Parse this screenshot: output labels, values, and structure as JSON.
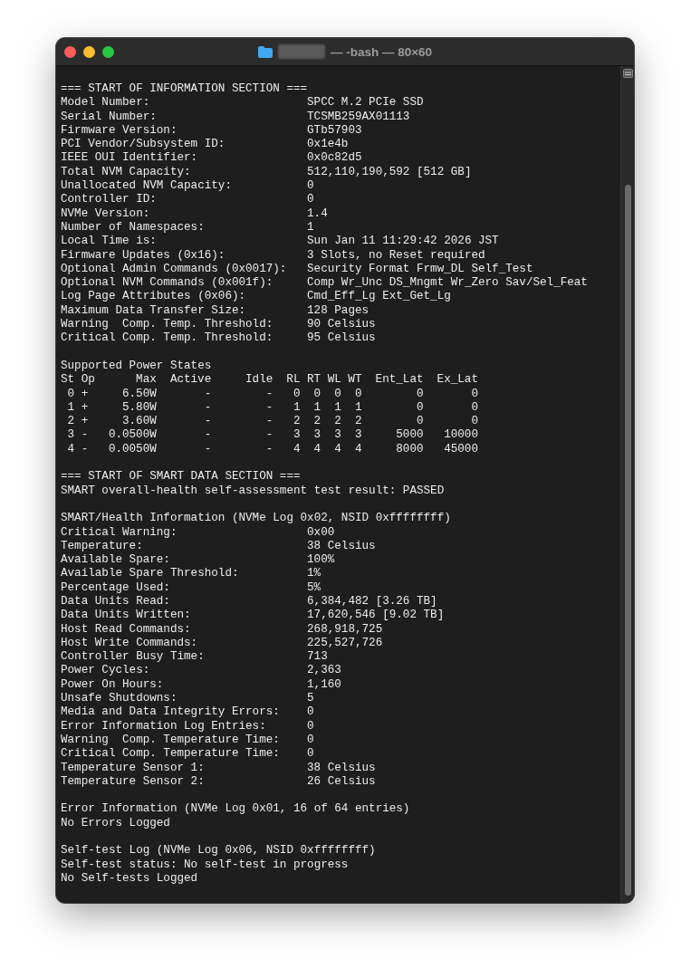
{
  "window": {
    "title": "— -bash — 80×60"
  },
  "blocks": [
    {
      "kind": "fields",
      "heading": "=== START OF INFORMATION SECTION ===",
      "fields": [
        {
          "label": "Model Number:",
          "value": "SPCC M.2 PCIe SSD"
        },
        {
          "label": "Serial Number:",
          "value": "TCSMB259AX01113"
        },
        {
          "label": "Firmware Version:",
          "value": "GTb57903"
        },
        {
          "label": "PCI Vendor/Subsystem ID:",
          "value": "0x1e4b"
        },
        {
          "label": "IEEE OUI Identifier:",
          "value": "0x0c82d5"
        },
        {
          "label": "Total NVM Capacity:",
          "value": "512,110,190,592 [512 GB]"
        },
        {
          "label": "Unallocated NVM Capacity:",
          "value": "0"
        },
        {
          "label": "Controller ID:",
          "value": "0"
        },
        {
          "label": "NVMe Version:",
          "value": "1.4"
        },
        {
          "label": "Number of Namespaces:",
          "value": "1"
        },
        {
          "label": "Local Time is:",
          "value": "Sun Jan 11 11:29:42 2026 JST"
        },
        {
          "label": "Firmware Updates (0x16):",
          "value": "3 Slots, no Reset required"
        },
        {
          "label": "Optional Admin Commands (0x0017):",
          "value": "Security Format Frmw_DL Self_Test"
        },
        {
          "label": "Optional NVM Commands (0x001f):",
          "value": "Comp Wr_Unc DS_Mngmt Wr_Zero Sav/Sel_Feat"
        },
        {
          "label": "Log Page Attributes (0x06):",
          "value": "Cmd_Eff_Lg Ext_Get_Lg"
        },
        {
          "label": "Maximum Data Transfer Size:",
          "value": "128 Pages"
        },
        {
          "label": "Warning  Comp. Temp. Threshold:",
          "value": "90 Celsius"
        },
        {
          "label": "Critical Comp. Temp. Threshold:",
          "value": "95 Celsius"
        }
      ]
    },
    {
      "kind": "table",
      "heading": "Supported Power States",
      "columns": [
        "St",
        "Op",
        "Max",
        "Active",
        "Idle",
        "RL",
        "RT",
        "WL",
        "WT",
        "Ent_Lat",
        "Ex_Lat"
      ],
      "rows": [
        [
          "0",
          "+",
          "6.50W",
          "-",
          "-",
          "0",
          "0",
          "0",
          "0",
          "0",
          "0"
        ],
        [
          "1",
          "+",
          "5.80W",
          "-",
          "-",
          "1",
          "1",
          "1",
          "1",
          "0",
          "0"
        ],
        [
          "2",
          "+",
          "3.60W",
          "-",
          "-",
          "2",
          "2",
          "2",
          "2",
          "0",
          "0"
        ],
        [
          "3",
          "-",
          "0.0500W",
          "-",
          "-",
          "3",
          "3",
          "3",
          "3",
          "5000",
          "10000"
        ],
        [
          "4",
          "-",
          "0.0050W",
          "-",
          "-",
          "4",
          "4",
          "4",
          "4",
          "8000",
          "45000"
        ]
      ]
    },
    {
      "kind": "lines",
      "lines": [
        "=== START OF SMART DATA SECTION ===",
        "SMART overall-health self-assessment test result: PASSED"
      ]
    },
    {
      "kind": "fields",
      "heading": "SMART/Health Information (NVMe Log 0x02, NSID 0xffffffff)",
      "fields": [
        {
          "label": "Critical Warning:",
          "value": "0x00"
        },
        {
          "label": "Temperature:",
          "value": "38 Celsius"
        },
        {
          "label": "Available Spare:",
          "value": "100%"
        },
        {
          "label": "Available Spare Threshold:",
          "value": "1%"
        },
        {
          "label": "Percentage Used:",
          "value": "5%"
        },
        {
          "label": "Data Units Read:",
          "value": "6,384,482 [3.26 TB]"
        },
        {
          "label": "Data Units Written:",
          "value": "17,620,546 [9.02 TB]"
        },
        {
          "label": "Host Read Commands:",
          "value": "268,918,725"
        },
        {
          "label": "Host Write Commands:",
          "value": "225,527,726"
        },
        {
          "label": "Controller Busy Time:",
          "value": "713"
        },
        {
          "label": "Power Cycles:",
          "value": "2,363"
        },
        {
          "label": "Power On Hours:",
          "value": "1,160"
        },
        {
          "label": "Unsafe Shutdowns:",
          "value": "5"
        },
        {
          "label": "Media and Data Integrity Errors:",
          "value": "0"
        },
        {
          "label": "Error Information Log Entries:",
          "value": "0"
        },
        {
          "label": "Warning  Comp. Temperature Time:",
          "value": "0"
        },
        {
          "label": "Critical Comp. Temperature Time:",
          "value": "0"
        },
        {
          "label": "Temperature Sensor 1:",
          "value": "38 Celsius"
        },
        {
          "label": "Temperature Sensor 2:",
          "value": "26 Celsius"
        }
      ]
    },
    {
      "kind": "lines",
      "lines": [
        "Error Information (NVMe Log 0x01, 16 of 64 entries)",
        "No Errors Logged"
      ]
    },
    {
      "kind": "lines",
      "lines": [
        "Self-test Log (NVMe Log 0x06, NSID 0xffffffff)",
        "Self-test status: No self-test in progress",
        "No Self-tests Logged"
      ]
    }
  ]
}
